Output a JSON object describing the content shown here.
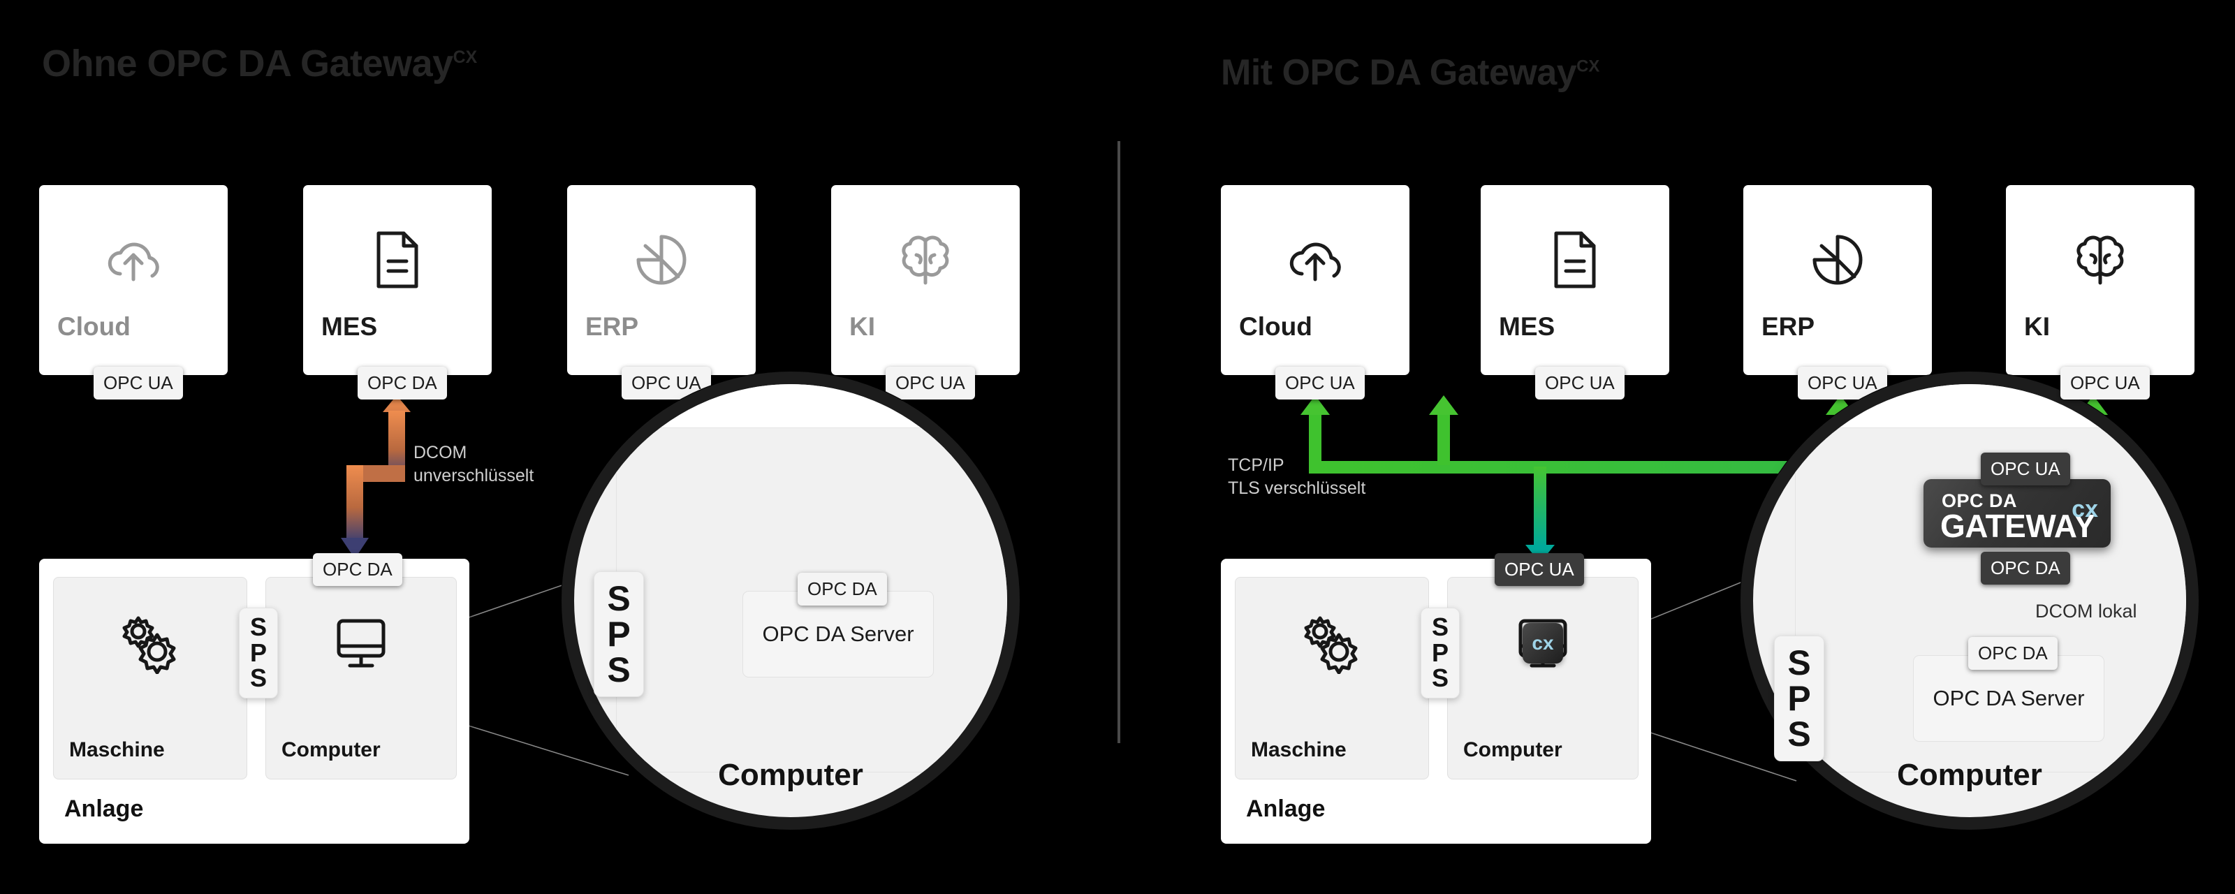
{
  "panels": {
    "left": {
      "title": "Ohne OPC DA Gateway",
      "title_sup": "CX",
      "apps": [
        {
          "name": "Cloud",
          "icon": "cloud-upload-icon",
          "active": false,
          "badge": "OPC UA"
        },
        {
          "name": "MES",
          "icon": "document-icon",
          "active": true,
          "badge": "OPC DA"
        },
        {
          "name": "ERP",
          "icon": "donut-chart-icon",
          "active": false,
          "badge": "OPC UA"
        },
        {
          "name": "KI",
          "icon": "brain-icon",
          "active": false,
          "badge": "OPC UA"
        }
      ],
      "connection_note": "DCOM\nunverschlüsselt",
      "plant": {
        "label": "Anlage",
        "machine": {
          "label": "Maschine",
          "icon": "gears-icon"
        },
        "computer": {
          "label": "Computer",
          "icon": "monitor-icon"
        },
        "sps": "SPS",
        "computer_badge": "OPC DA"
      },
      "magnifier": {
        "label": "Computer",
        "sps": "SPS",
        "server_box": "OPC DA Server",
        "server_badge": "OPC DA"
      }
    },
    "right": {
      "title": "Mit OPC DA Gateway",
      "title_sup": "CX",
      "apps": [
        {
          "name": "Cloud",
          "icon": "cloud-upload-icon",
          "active": true,
          "badge": "OPC UA"
        },
        {
          "name": "MES",
          "icon": "document-icon",
          "active": true,
          "badge": "OPC UA"
        },
        {
          "name": "ERP",
          "icon": "donut-chart-icon",
          "active": true,
          "badge": "OPC UA"
        },
        {
          "name": "KI",
          "icon": "brain-icon",
          "active": true,
          "badge": "OPC UA"
        }
      ],
      "connection_note": "TCP/IP\nTLS verschlüsselt",
      "plant": {
        "label": "Anlage",
        "machine": {
          "label": "Maschine",
          "icon": "gears-icon"
        },
        "computer": {
          "label": "Computer",
          "icon": "monitor-icon"
        },
        "sps": "SPS",
        "computer_badge": "OPC UA",
        "computer_chip": "cx"
      },
      "magnifier": {
        "label": "Computer",
        "sps": "SPS",
        "server_box": "OPC DA Server",
        "server_badge": "OPC DA",
        "gateway_badge_top": "OPC UA",
        "gateway_badge_bottom": "OPC DA",
        "gateway_logo_line1": "OPC DA",
        "gateway_logo_line2": "GATEWAY",
        "gateway_logo_mark": "cx",
        "local_note": "DCOM lokal"
      }
    }
  },
  "colors": {
    "background": "#000000",
    "title": "#262626",
    "card_active_text": "#1b1b1b",
    "card_inactive_text": "#8d8d8d",
    "arrow_unencrypted_start": "#ef8d4f",
    "arrow_unencrypted_end": "#3d3f72",
    "arrow_encrypted_start": "#46c431",
    "arrow_encrypted_end": "#00a99a",
    "badge_light_bg": "#f4f4f4",
    "badge_dark_bg": "#3b3b3b",
    "gateway_mark": "#9fd4e8"
  }
}
